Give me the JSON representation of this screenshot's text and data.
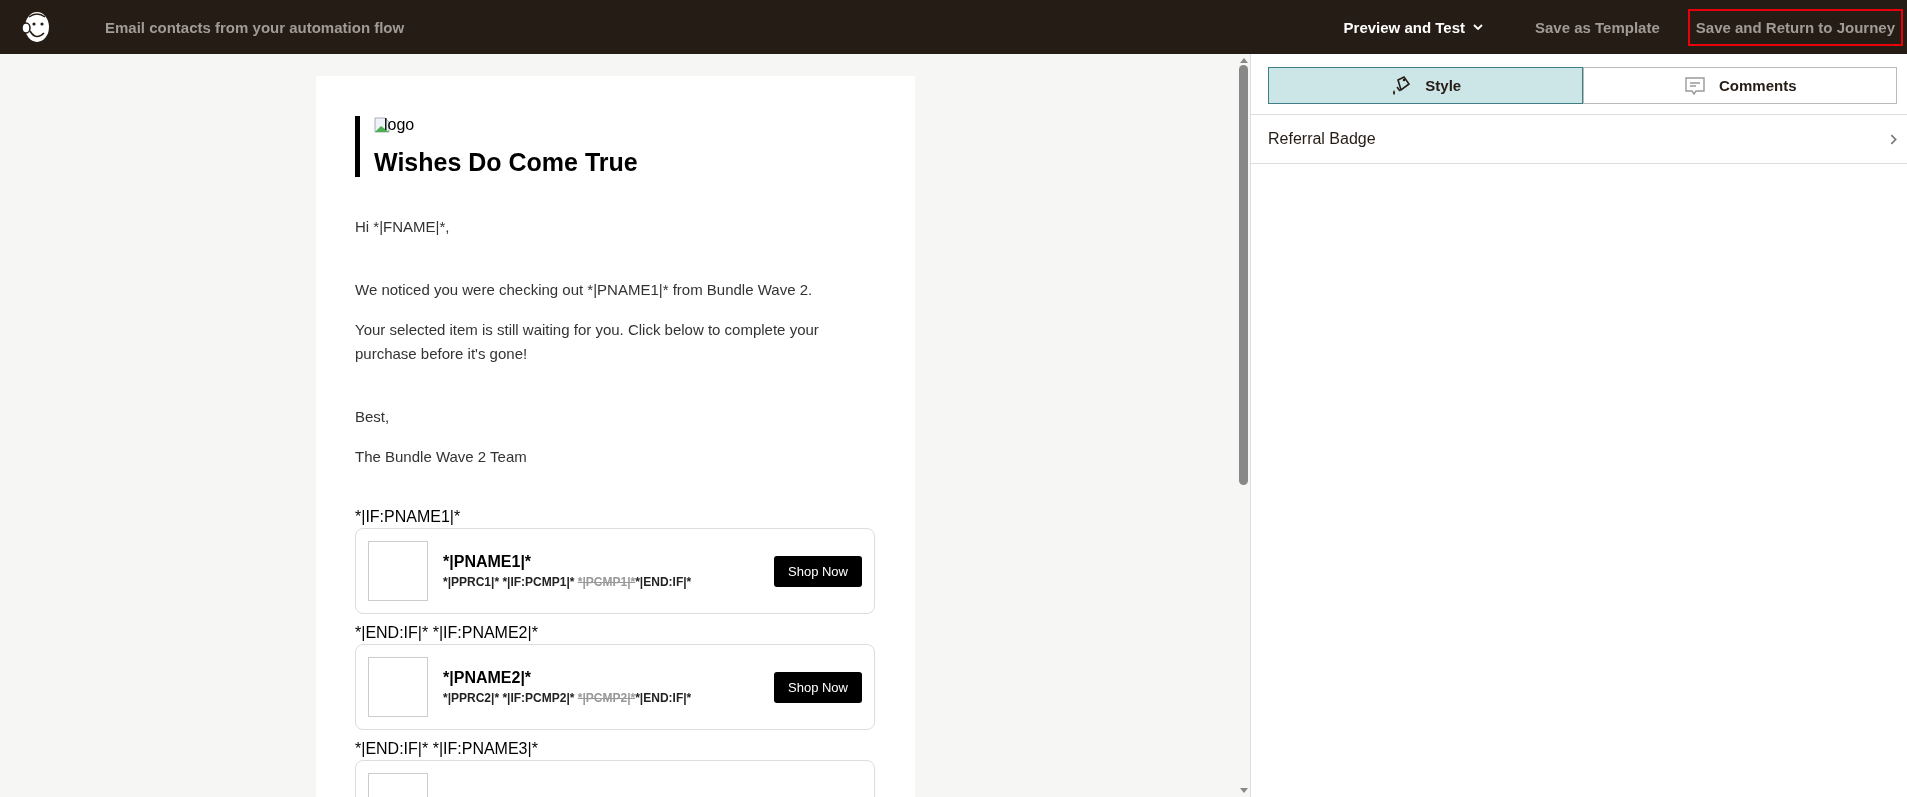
{
  "header": {
    "title": "Email contacts from your automation flow",
    "actions": [
      {
        "label": "Preview and Test",
        "kind": "menu",
        "highlighted": false
      },
      {
        "label": "Save as Template",
        "kind": "link",
        "highlighted": false
      },
      {
        "label": "Save and Return to Journey",
        "kind": "link",
        "highlighted": true
      }
    ]
  },
  "email": {
    "logo_alt": "logo",
    "heading": "Wishes Do Come True",
    "sections": [
      [
        "Hi *|FNAME|*,"
      ],
      [
        "We noticed you were checking out *|PNAME1|* from Bundle Wave 2.",
        "Your selected item is still waiting for you. Click below to complete your purchase before it's gone!"
      ],
      [
        "Best,",
        "The Bundle Wave 2 Team"
      ]
    ],
    "products": [
      {
        "condition": "*|IF:PNAME1|*",
        "name": "*|PNAME1|*",
        "price": "*|PPRC1|* *|IF:PCMP1|*",
        "compare_price": "*|PCMP1|*",
        "price_end": "*|END:IF|*",
        "button": "Shop Now"
      },
      {
        "condition": "*|END:IF|* *|IF:PNAME2|*",
        "name": "*|PNAME2|*",
        "price": "*|PPRC2|* *|IF:PCMP2|*",
        "compare_price": "*|PCMP2|*",
        "price_end": "*|END:IF|*",
        "button": "Shop Now"
      },
      {
        "condition": "*|END:IF|* *|IF:PNAME3|*"
      }
    ]
  },
  "panel": {
    "tabs": [
      {
        "label": "Style",
        "kind": "style",
        "selected": true
      },
      {
        "label": "Comments",
        "kind": "comments",
        "selected": false
      }
    ],
    "items": [
      {
        "label": "Referral Badge"
      }
    ]
  }
}
